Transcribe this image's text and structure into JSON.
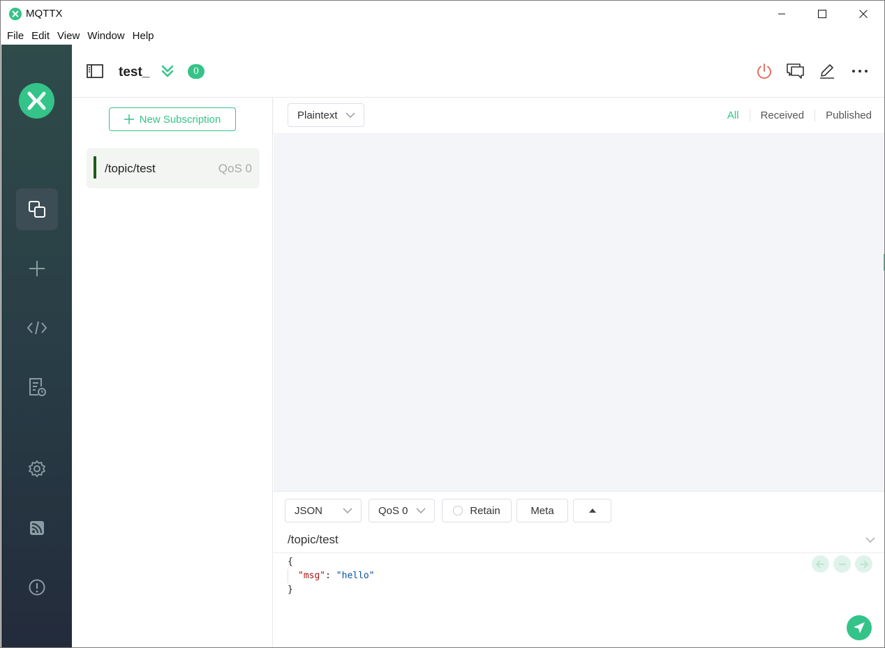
{
  "window": {
    "title": "MQTTX",
    "menu": [
      "File",
      "Edit",
      "View",
      "Window",
      "Help"
    ]
  },
  "header": {
    "connection_name": "test_",
    "message_count": "0"
  },
  "subscriptions": {
    "new_button_label": "New Subscription",
    "items": [
      {
        "topic": "/topic/test",
        "qos": "QoS 0",
        "color": "#1f5a1a"
      }
    ]
  },
  "messages": {
    "payload_format": "Plaintext",
    "filters": [
      "All",
      "Received",
      "Published"
    ],
    "active_filter": "All"
  },
  "publish": {
    "format": "JSON",
    "qos": "QoS 0",
    "retain_label": "Retain",
    "meta_label": "Meta",
    "topic": "/topic/test",
    "payload_lines": {
      "open": "{",
      "key": "\"msg\"",
      "colon": ": ",
      "value": "\"hello\"",
      "close": "}"
    }
  },
  "theme": {
    "accent": "#34c388",
    "nav_gradient_top": "#2f4b4a",
    "nav_gradient_bottom": "#232b3b",
    "disconnect_red": "#e8604c"
  }
}
